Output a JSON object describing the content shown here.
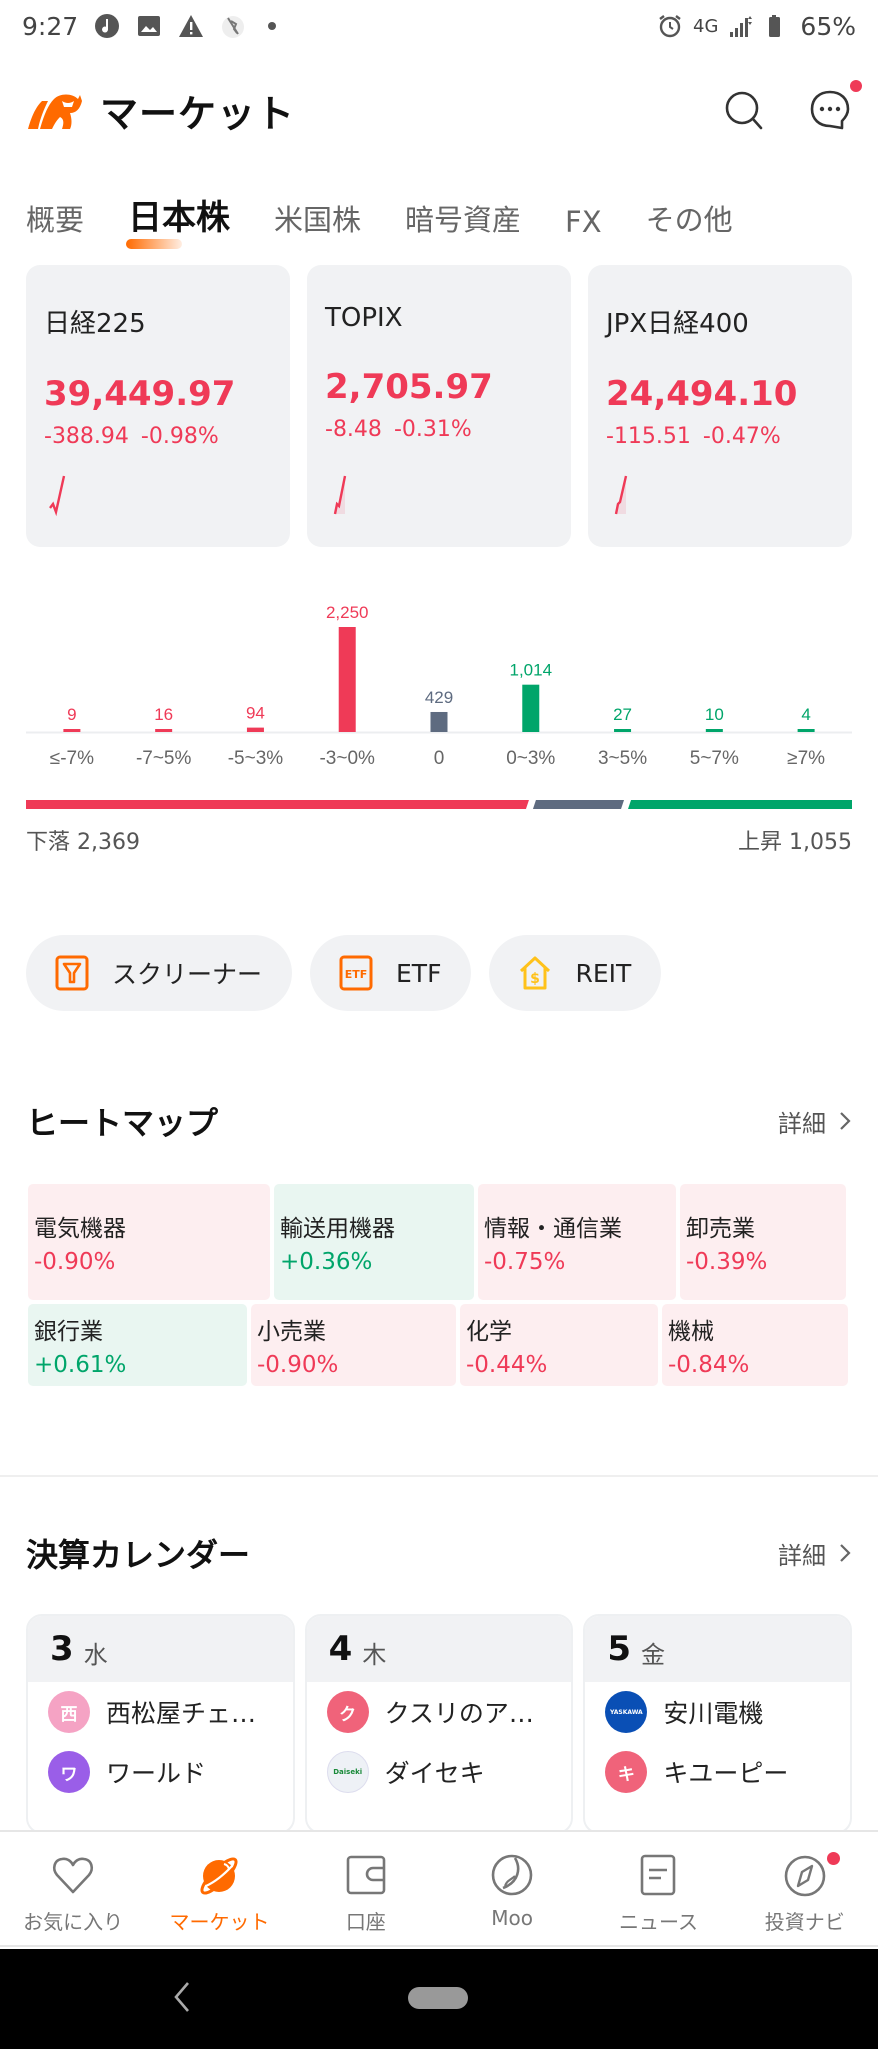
{
  "status_bar": {
    "time": "9:27",
    "network": "4G",
    "battery": "65%"
  },
  "header": {
    "title": "マーケット",
    "icons": [
      "bull-logo-icon",
      "search-icon",
      "message-icon"
    ],
    "message_badge": true
  },
  "tabs": [
    {
      "label": "概要",
      "active": false
    },
    {
      "label": "日本株",
      "active": true
    },
    {
      "label": "米国株",
      "active": false
    },
    {
      "label": "暗号資産",
      "active": false
    },
    {
      "label": "FX",
      "active": false
    },
    {
      "label": "その他",
      "active": false
    }
  ],
  "indices": [
    {
      "name": "日経225",
      "price": "39,449.97",
      "change": "-388.94",
      "change_pct": "-0.98%"
    },
    {
      "name": "TOPIX",
      "price": "2,705.97",
      "change": "-8.48",
      "change_pct": "-0.31%"
    },
    {
      "name": "JPX日経400",
      "price": "24,494.10",
      "change": "-115.51",
      "change_pct": "-0.47%"
    }
  ],
  "colors": {
    "down": "#ef3a57",
    "up": "#00a56a",
    "flat": "#5e6b80",
    "accent": "#ff6a00"
  },
  "chart_data": {
    "type": "bar",
    "title": "",
    "categories": [
      "≤-7%",
      "-7~5%",
      "-5~3%",
      "-3~0%",
      "0",
      "0~3%",
      "3~5%",
      "5~7%",
      "≥7%"
    ],
    "values": [
      9,
      16,
      94,
      2250,
      429,
      1014,
      27,
      10,
      4
    ],
    "value_labels": [
      "9",
      "16",
      "94",
      "2,250",
      "429",
      "1,014",
      "27",
      "10",
      "4"
    ],
    "bar_colors": [
      "down",
      "down",
      "down",
      "down",
      "flat",
      "up",
      "up",
      "up",
      "up"
    ],
    "xlabel": "",
    "ylabel": "",
    "ylim": [
      0,
      2250
    ],
    "grid": false
  },
  "breadth": {
    "down_label": "下落",
    "down_count": "2,369",
    "up_label": "上昇",
    "up_count": "1,055",
    "flat_count": 429
  },
  "quick_buttons": [
    {
      "label": "スクリーナー",
      "icon": "screener-filter-icon"
    },
    {
      "label": "ETF",
      "icon": "etf-icon"
    },
    {
      "label": "REIT",
      "icon": "reit-house-icon"
    }
  ],
  "heatmap": {
    "title": "ヒートマップ",
    "more": "詳細",
    "rows": [
      [
        {
          "name": "電気機器",
          "value": "-0.90%",
          "dir": "neg"
        },
        {
          "name": "輸送用機器",
          "value": "+0.36%",
          "dir": "pos"
        },
        {
          "name": "情報・通信業",
          "value": "-0.75%",
          "dir": "neg"
        },
        {
          "name": "卸売業",
          "value": "-0.39%",
          "dir": "neg"
        }
      ],
      [
        {
          "name": "銀行業",
          "value": "+0.61%",
          "dir": "pos"
        },
        {
          "name": "小売業",
          "value": "-0.90%",
          "dir": "neg"
        },
        {
          "name": "化学",
          "value": "-0.44%",
          "dir": "neg"
        },
        {
          "name": "機械",
          "value": "-0.84%",
          "dir": "neg"
        }
      ]
    ]
  },
  "earnings": {
    "title": "決算カレンダー",
    "more": "詳細",
    "days": [
      {
        "day": "3",
        "dow": "水",
        "items": [
          {
            "logo_text": "西",
            "logo_color": "#f5a3c4",
            "name": "西松屋チェ…"
          },
          {
            "logo_text": "ワ",
            "logo_color": "#9a5ee8",
            "name": "ワールド"
          }
        ]
      },
      {
        "day": "4",
        "dow": "木",
        "items": [
          {
            "logo_text": "ク",
            "logo_color": "#f0637a",
            "name": "クスリのア…"
          },
          {
            "logo_text": "Daiseki",
            "logo_color": "#eef1f6",
            "name": "ダイセキ"
          }
        ]
      },
      {
        "day": "5",
        "dow": "金",
        "items": [
          {
            "logo_text": "YASKAWA",
            "logo_color": "#0a4fb5",
            "name": "安川電機"
          },
          {
            "logo_text": "キ",
            "logo_color": "#f0637a",
            "name": "キユーピー"
          }
        ]
      }
    ]
  },
  "bottom_nav": [
    {
      "label": "お気に入り",
      "icon": "heart-icon",
      "active": false
    },
    {
      "label": "マーケット",
      "icon": "planet-icon",
      "active": true
    },
    {
      "label": "口座",
      "icon": "wallet-icon",
      "active": false
    },
    {
      "label": "Moo",
      "icon": "moo-icon",
      "active": false
    },
    {
      "label": "ニュース",
      "icon": "news-icon",
      "active": false
    },
    {
      "label": "投資ナビ",
      "icon": "compass-icon",
      "active": false,
      "badge": true
    }
  ]
}
